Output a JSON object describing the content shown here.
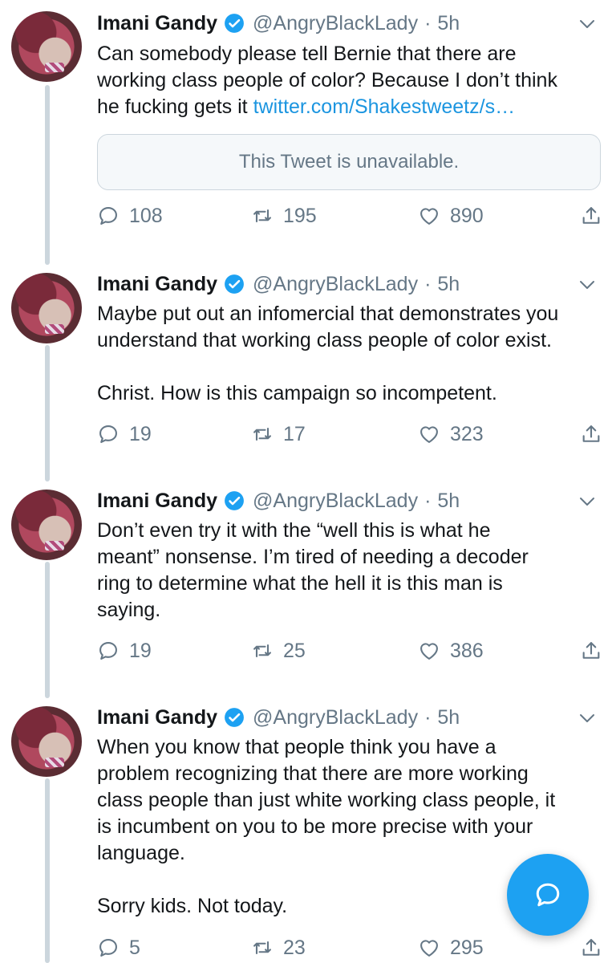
{
  "colors": {
    "accent": "#1da1f2",
    "link": "#1b95e0",
    "muted": "#657786",
    "thread_line": "#ccd6dd"
  },
  "tweets": [
    {
      "name": "Imani Gandy",
      "handle": "@AngryBlackLady",
      "sep": "·",
      "time": "5h",
      "text_lines": [
        "Can somebody please tell Bernie that there are",
        "working class people of color? Because I don’t think"
      ],
      "text_prefix": "he fucking gets it ",
      "link": "twitter.com/Shakestweetz/s…",
      "quote": "This Tweet is unavailable.",
      "replies": "108",
      "retweets": "195",
      "likes": "890"
    },
    {
      "name": "Imani Gandy",
      "handle": "@AngryBlackLady",
      "sep": "·",
      "time": "5h",
      "text_lines": [
        "Maybe put out an infomercial that demonstrates you",
        "understand that working class people of color exist."
      ],
      "text_para2": "Christ. How is this campaign so incompetent.",
      "replies": "19",
      "retweets": "17",
      "likes": "323"
    },
    {
      "name": "Imani Gandy",
      "handle": "@AngryBlackLady",
      "sep": "·",
      "time": "5h",
      "text_lines": [
        "Don’t even try it with the “well this is what he",
        "meant” nonsense. I’m tired of needing a decoder",
        "ring to determine what the hell it is this man is",
        "saying."
      ],
      "replies": "19",
      "retweets": "25",
      "likes": "386"
    },
    {
      "name": "Imani Gandy",
      "handle": "@AngryBlackLady",
      "sep": "·",
      "time": "5h",
      "text_lines": [
        "When you know that people think you have a",
        "problem recognizing that there are more working",
        "class people than just white working class people, it",
        "is incumbent on you to be more precise with your",
        "language."
      ],
      "text_para2": "Sorry kids. Not today.",
      "replies": "5",
      "retweets": "23",
      "likes": "295"
    }
  ]
}
